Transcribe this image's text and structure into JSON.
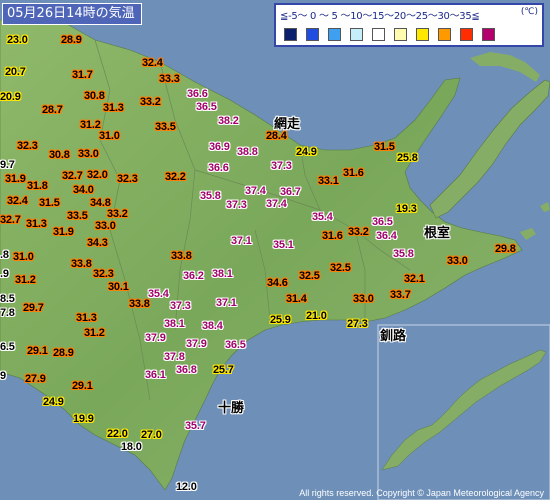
{
  "title": "05月26日14時の気温",
  "legend": {
    "label": "≦-5～ 0 ～ 5 ～10～15～20～25～30～35≦",
    "unit": "(℃)",
    "colors": [
      "#0a1f6e",
      "#1f4de0",
      "#3da0f0",
      "#c6eefa",
      "#ffffff",
      "#fffcb0",
      "#ffe800",
      "#ff9900",
      "#ff2d00",
      "#b4006c"
    ]
  },
  "places": {
    "abashiri": "網走",
    "nemuro": "根室",
    "kushiro": "釧路",
    "tokachi": "十勝"
  },
  "copyright": "All rights reserved. Copyright © Japan Meteorological Agency",
  "temperatures": [
    {
      "v": "23.0",
      "c": "warm",
      "pos": [
        7,
        34
      ]
    },
    {
      "v": "28.9",
      "c": "hot",
      "pos": [
        61,
        34
      ]
    },
    {
      "v": "20.7",
      "c": "warm",
      "pos": [
        5,
        66
      ]
    },
    {
      "v": "31.7",
      "c": "hot",
      "pos": [
        72,
        69
      ]
    },
    {
      "v": "32.4",
      "c": "hot",
      "pos": [
        142,
        57
      ]
    },
    {
      "v": "33.3",
      "c": "hot",
      "pos": [
        159,
        73
      ]
    },
    {
      "v": "20.9",
      "c": "warm",
      "pos": [
        0,
        91
      ]
    },
    {
      "v": "30.8",
      "c": "hot",
      "pos": [
        84,
        90
      ]
    },
    {
      "v": "33.2",
      "c": "hot",
      "pos": [
        140,
        96
      ]
    },
    {
      "v": "36.6",
      "c": "vhot",
      "pos": [
        187,
        88
      ]
    },
    {
      "v": "28.7",
      "c": "hot",
      "pos": [
        42,
        104
      ]
    },
    {
      "v": "31.3",
      "c": "hot",
      "pos": [
        103,
        102
      ]
    },
    {
      "v": "36.5",
      "c": "vhot",
      "pos": [
        196,
        101
      ]
    },
    {
      "v": "31.2",
      "c": "hot",
      "pos": [
        80,
        119
      ]
    },
    {
      "v": "33.5",
      "c": "hot",
      "pos": [
        155,
        121
      ]
    },
    {
      "v": "38.2",
      "c": "vhot",
      "pos": [
        218,
        115
      ]
    },
    {
      "v": "31.0",
      "c": "hot",
      "pos": [
        99,
        130
      ]
    },
    {
      "v": "28.4",
      "c": "hot",
      "pos": [
        266,
        130
      ]
    },
    {
      "v": "32.3",
      "c": "hot",
      "pos": [
        17,
        140
      ]
    },
    {
      "v": "36.9",
      "c": "vhot",
      "pos": [
        209,
        141
      ]
    },
    {
      "v": "38.8",
      "c": "vhot",
      "pos": [
        237,
        146
      ]
    },
    {
      "v": "24.9",
      "c": "warm",
      "pos": [
        296,
        146
      ]
    },
    {
      "v": "31.5",
      "c": "hot",
      "pos": [
        374,
        141
      ]
    },
    {
      "v": "30.8",
      "c": "hot",
      "pos": [
        49,
        149
      ]
    },
    {
      "v": "33.0",
      "c": "hot",
      "pos": [
        78,
        148
      ]
    },
    {
      "v": "25.8",
      "c": "warm",
      "pos": [
        397,
        152
      ]
    },
    {
      "v": "9.7",
      "c": "mild",
      "pos": [
        0,
        159
      ]
    },
    {
      "v": "36.6",
      "c": "vhot",
      "pos": [
        208,
        162
      ]
    },
    {
      "v": "37.3",
      "c": "vhot",
      "pos": [
        271,
        160
      ]
    },
    {
      "v": "32.7",
      "c": "hot",
      "pos": [
        62,
        170
      ]
    },
    {
      "v": "32.0",
      "c": "hot",
      "pos": [
        87,
        169
      ]
    },
    {
      "v": "32.3",
      "c": "hot",
      "pos": [
        117,
        173
      ]
    },
    {
      "v": "32.2",
      "c": "hot",
      "pos": [
        165,
        171
      ]
    },
    {
      "v": "31.6",
      "c": "hot",
      "pos": [
        343,
        167
      ]
    },
    {
      "v": "33.1",
      "c": "hot",
      "pos": [
        318,
        175
      ]
    },
    {
      "v": "31.9",
      "c": "hot",
      "pos": [
        5,
        173
      ]
    },
    {
      "v": "31.8",
      "c": "hot",
      "pos": [
        27,
        180
      ]
    },
    {
      "v": "34.0",
      "c": "hot",
      "pos": [
        73,
        184
      ]
    },
    {
      "v": "37.4",
      "c": "vhot",
      "pos": [
        245,
        185
      ]
    },
    {
      "v": "36.7",
      "c": "vhot",
      "pos": [
        280,
        186
      ]
    },
    {
      "v": "35.8",
      "c": "vhot",
      "pos": [
        200,
        190
      ]
    },
    {
      "v": "32.4",
      "c": "hot",
      "pos": [
        7,
        195
      ]
    },
    {
      "v": "31.5",
      "c": "hot",
      "pos": [
        39,
        197
      ]
    },
    {
      "v": "34.8",
      "c": "hot",
      "pos": [
        90,
        197
      ]
    },
    {
      "v": "37.3",
      "c": "vhot",
      "pos": [
        226,
        199
      ]
    },
    {
      "v": "37.4",
      "c": "vhot",
      "pos": [
        266,
        198
      ]
    },
    {
      "v": "19.3",
      "c": "warm",
      "pos": [
        396,
        203
      ]
    },
    {
      "v": "32.7",
      "c": "hot",
      "pos": [
        0,
        214
      ]
    },
    {
      "v": "31.3",
      "c": "hot",
      "pos": [
        26,
        218
      ]
    },
    {
      "v": "33.5",
      "c": "hot",
      "pos": [
        67,
        210
      ]
    },
    {
      "v": "33.2",
      "c": "hot",
      "pos": [
        107,
        208
      ]
    },
    {
      "v": "35.4",
      "c": "vhot",
      "pos": [
        312,
        211
      ]
    },
    {
      "v": "36.5",
      "c": "vhot",
      "pos": [
        372,
        216
      ]
    },
    {
      "v": "33.0",
      "c": "hot",
      "pos": [
        95,
        220
      ]
    },
    {
      "v": "31.9",
      "c": "hot",
      "pos": [
        53,
        226
      ]
    },
    {
      "v": "31.6",
      "c": "hot",
      "pos": [
        322,
        230
      ]
    },
    {
      "v": "33.2",
      "c": "hot",
      "pos": [
        348,
        226
      ]
    },
    {
      "v": "36.4",
      "c": "vhot",
      "pos": [
        376,
        230
      ]
    },
    {
      "v": "37.1",
      "c": "vhot",
      "pos": [
        231,
        235
      ]
    },
    {
      "v": "35.1",
      "c": "vhot",
      "pos": [
        273,
        239
      ]
    },
    {
      "v": "34.3",
      "c": "hot",
      "pos": [
        87,
        237
      ]
    },
    {
      "v": "29.8",
      "c": "hot",
      "pos": [
        495,
        243
      ]
    },
    {
      "v": ".8",
      "c": "mild",
      "pos": [
        0,
        249
      ]
    },
    {
      "v": "31.0",
      "c": "hot",
      "pos": [
        13,
        251
      ]
    },
    {
      "v": "35.8",
      "c": "vhot",
      "pos": [
        393,
        248
      ]
    },
    {
      "v": "33.8",
      "c": "hot",
      "pos": [
        171,
        250
      ]
    },
    {
      "v": "33.0",
      "c": "hot",
      "pos": [
        447,
        255
      ]
    },
    {
      "v": "33.8",
      "c": "hot",
      "pos": [
        71,
        258
      ]
    },
    {
      "v": "32.5",
      "c": "hot",
      "pos": [
        330,
        262
      ]
    },
    {
      "v": ".9",
      "c": "mild",
      "pos": [
        0,
        268
      ]
    },
    {
      "v": "32.3",
      "c": "hot",
      "pos": [
        93,
        268
      ]
    },
    {
      "v": "36.2",
      "c": "vhot",
      "pos": [
        183,
        270
      ]
    },
    {
      "v": "38.1",
      "c": "vhot",
      "pos": [
        212,
        268
      ]
    },
    {
      "v": "32.5",
      "c": "hot",
      "pos": [
        299,
        270
      ]
    },
    {
      "v": "32.1",
      "c": "hot",
      "pos": [
        404,
        273
      ]
    },
    {
      "v": "31.2",
      "c": "hot",
      "pos": [
        15,
        274
      ]
    },
    {
      "v": "30.1",
      "c": "hot",
      "pos": [
        108,
        281
      ]
    },
    {
      "v": "34.6",
      "c": "hot",
      "pos": [
        267,
        277
      ]
    },
    {
      "v": "35.4",
      "c": "vhot",
      "pos": [
        148,
        288
      ]
    },
    {
      "v": "31.4",
      "c": "hot",
      "pos": [
        286,
        293
      ]
    },
    {
      "v": "33.0",
      "c": "hot",
      "pos": [
        353,
        293
      ]
    },
    {
      "v": "33.7",
      "c": "hot",
      "pos": [
        390,
        289
      ]
    },
    {
      "v": "8.5",
      "c": "mild",
      "pos": [
        0,
        293
      ]
    },
    {
      "v": "29.7",
      "c": "hot",
      "pos": [
        23,
        302
      ]
    },
    {
      "v": "33.8",
      "c": "hot",
      "pos": [
        129,
        298
      ]
    },
    {
      "v": "37.3",
      "c": "vhot",
      "pos": [
        170,
        300
      ]
    },
    {
      "v": "37.1",
      "c": "vhot",
      "pos": [
        216,
        297
      ]
    },
    {
      "v": "7.8",
      "c": "mild",
      "pos": [
        0,
        307
      ]
    },
    {
      "v": "21.0",
      "c": "warm",
      "pos": [
        306,
        310
      ]
    },
    {
      "v": "31.3",
      "c": "hot",
      "pos": [
        76,
        312
      ]
    },
    {
      "v": "25.9",
      "c": "warm",
      "pos": [
        270,
        314
      ]
    },
    {
      "v": "38.1",
      "c": "vhot",
      "pos": [
        164,
        318
      ]
    },
    {
      "v": "38.4",
      "c": "vhot",
      "pos": [
        202,
        320
      ]
    },
    {
      "v": "27.3",
      "c": "warm",
      "pos": [
        347,
        318
      ]
    },
    {
      "v": "31.2",
      "c": "hot",
      "pos": [
        84,
        327
      ]
    },
    {
      "v": "37.9",
      "c": "vhot",
      "pos": [
        145,
        332
      ]
    },
    {
      "v": "37.9",
      "c": "vhot",
      "pos": [
        186,
        338
      ]
    },
    {
      "v": "36.5",
      "c": "vhot",
      "pos": [
        225,
        339
      ]
    },
    {
      "v": "6.5",
      "c": "mild",
      "pos": [
        0,
        341
      ]
    },
    {
      "v": "29.1",
      "c": "hot",
      "pos": [
        27,
        345
      ]
    },
    {
      "v": "28.9",
      "c": "hot",
      "pos": [
        53,
        347
      ]
    },
    {
      "v": "37.8",
      "c": "vhot",
      "pos": [
        164,
        351
      ]
    },
    {
      "v": "36.8",
      "c": "vhot",
      "pos": [
        176,
        364
      ]
    },
    {
      "v": "36.1",
      "c": "vhot",
      "pos": [
        145,
        369
      ]
    },
    {
      "v": "25.7",
      "c": "warm",
      "pos": [
        213,
        364
      ]
    },
    {
      "v": "27.9",
      "c": "hot",
      "pos": [
        25,
        373
      ]
    },
    {
      "v": "9",
      "c": "mild",
      "pos": [
        0,
        370
      ]
    },
    {
      "v": "29.1",
      "c": "hot",
      "pos": [
        72,
        380
      ]
    },
    {
      "v": "24.9",
      "c": "warm",
      "pos": [
        43,
        396
      ]
    },
    {
      "v": "19.9",
      "c": "warm",
      "pos": [
        73,
        413
      ]
    },
    {
      "v": "35.7",
      "c": "vhot",
      "pos": [
        185,
        420
      ]
    },
    {
      "v": "22.0",
      "c": "warm",
      "pos": [
        107,
        428
      ]
    },
    {
      "v": "27.0",
      "c": "warm",
      "pos": [
        141,
        429
      ]
    },
    {
      "v": "18.0",
      "c": "mild",
      "pos": [
        121,
        441
      ]
    },
    {
      "v": "12.0",
      "c": "mild",
      "pos": [
        176,
        481
      ]
    }
  ]
}
